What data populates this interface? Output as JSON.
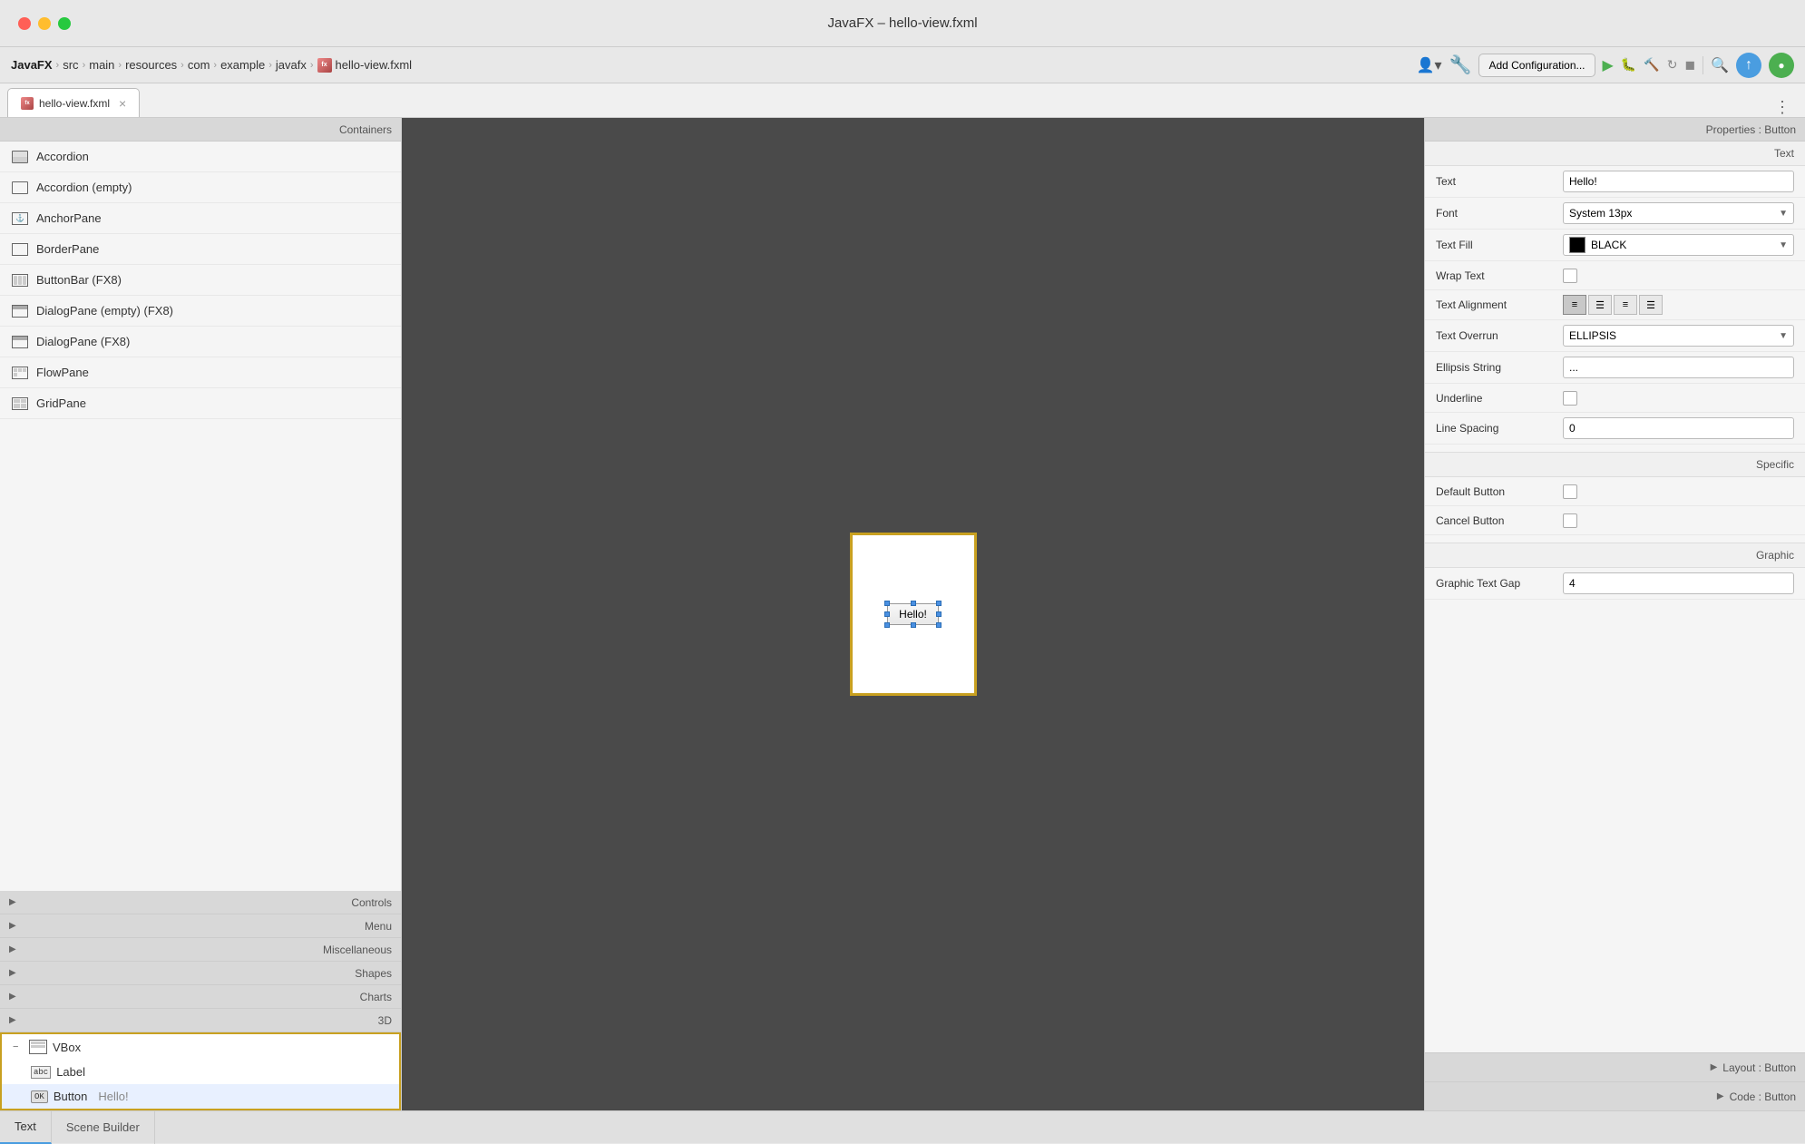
{
  "window": {
    "title": "JavaFX – hello-view.fxml"
  },
  "titlebar": {
    "title": "JavaFX – hello-view.fxml",
    "traffic": [
      "red",
      "yellow",
      "green"
    ]
  },
  "breadcrumb": {
    "items": [
      "JavaFX",
      "src",
      "main",
      "resources",
      "com",
      "example",
      "javafx"
    ],
    "file": "hello-view.fxml",
    "add_config": "Add Configuration...",
    "file_icon_text": "fx"
  },
  "tabs": {
    "active_tab": "hello-view.fxml",
    "file_icon_text": "fx"
  },
  "left_panel": {
    "containers_label": "Containers",
    "components": [
      "Accordion",
      "Accordion  (empty)",
      "AnchorPane",
      "BorderPane",
      "ButtonBar  (FX8)",
      "DialogPane (empty)  (FX8)",
      "DialogPane  (FX8)",
      "FlowPane",
      "GridPane"
    ],
    "controls_label": "Controls",
    "menu_label": "Menu",
    "misc_label": "Miscellaneous",
    "shapes_label": "Shapes",
    "charts_label": "Charts",
    "d3_label": "3D",
    "tree": {
      "vbox_label": "VBox",
      "label_label": "Label",
      "button_label": "Button",
      "button_text": "Hello!"
    }
  },
  "center": {
    "button_text": "Hello!"
  },
  "right_panel": {
    "header": "Properties : Button",
    "text_section": "Text",
    "properties": {
      "text_label": "Text",
      "text_value": "Hello!",
      "font_label": "Font",
      "font_value": "System 13px",
      "text_fill_label": "Text Fill",
      "text_fill_value": "BLACK",
      "wrap_text_label": "Wrap Text",
      "text_alignment_label": "Text Alignment",
      "text_overrun_label": "Text Overrun",
      "text_overrun_value": "ELLIPSIS",
      "ellipsis_string_label": "Ellipsis String",
      "ellipsis_string_value": "...",
      "underline_label": "Underline",
      "line_spacing_label": "Line Spacing",
      "line_spacing_value": "0"
    },
    "specific_section": "Specific",
    "specific_properties": {
      "default_button_label": "Default Button",
      "cancel_button_label": "Cancel Button"
    },
    "graphic_section": "Graphic",
    "graphic_properties": {
      "graphic_text_gap_label": "Graphic Text Gap",
      "graphic_text_gap_value": "4"
    },
    "layout_section": "Layout : Button",
    "code_section": "Code : Button"
  },
  "bottom_tabs": {
    "text_tab": "Text",
    "scene_builder_tab": "Scene Builder"
  }
}
